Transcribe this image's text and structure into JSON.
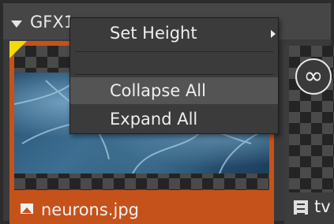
{
  "group": {
    "title": "GFX1"
  },
  "tiles": [
    {
      "label": "neurons.jpg",
      "icon": "image-icon",
      "accent": "#c5521b"
    },
    {
      "label": "tv",
      "icon": "film-icon",
      "badge": "∞"
    }
  ],
  "context_menu": {
    "items": [
      {
        "label": "Set Height",
        "has_submenu": true
      },
      {
        "label": ""
      },
      {
        "label": "Collapse All"
      },
      {
        "label": "Expand All"
      }
    ]
  }
}
